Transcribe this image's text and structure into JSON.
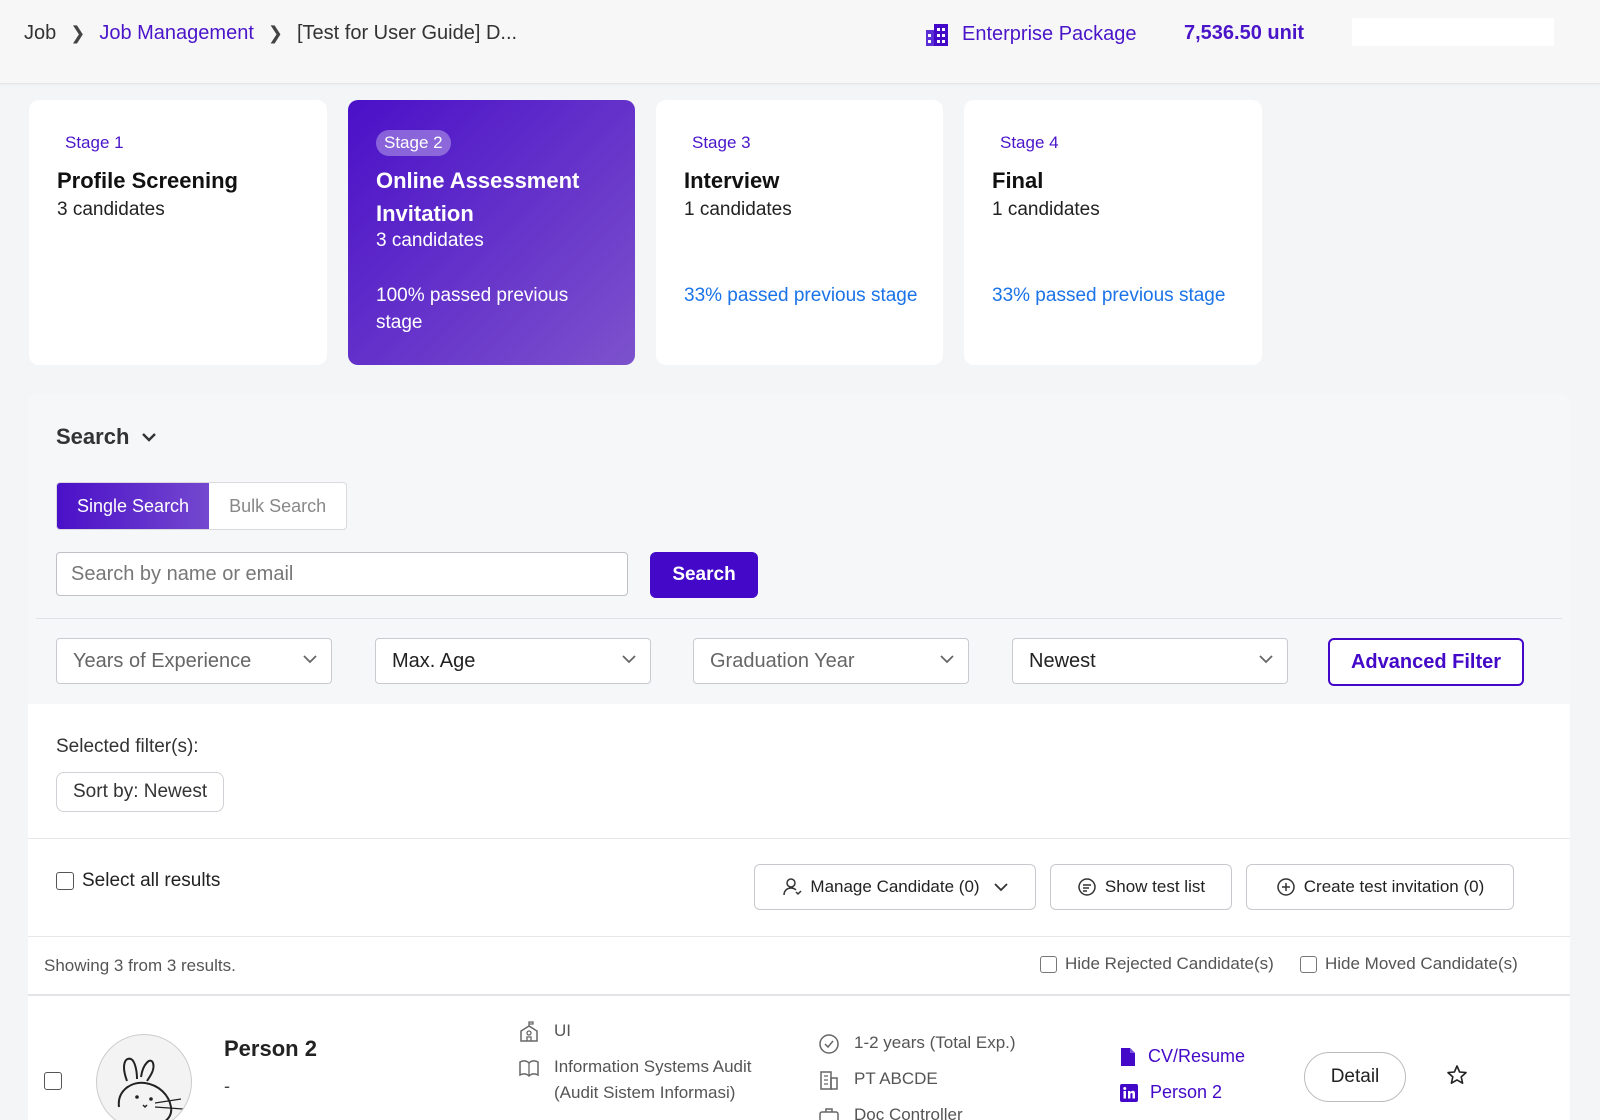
{
  "header": {
    "breadcrumb": [
      "Job",
      "Job Management",
      "[Test for User Guide] D..."
    ],
    "package_label": "Enterprise Package",
    "units": "7,536.50 unit",
    "accent_color": "#4308c8"
  },
  "stages": [
    {
      "label": "Stage 1",
      "title": "Profile Screening",
      "count": "3 candidates",
      "pass": ""
    },
    {
      "label": "Stage 2",
      "title": "Online Assessment Invitation",
      "count": "3 candidates",
      "pass": "100% passed previous stage"
    },
    {
      "label": "Stage 3",
      "title": "Interview",
      "count": "1 candidates",
      "pass": "33% passed previous stage"
    },
    {
      "label": "Stage 4",
      "title": "Final",
      "count": "1 candidates",
      "pass": "33% passed previous stage"
    }
  ],
  "search": {
    "heading": "Search",
    "tabs": [
      "Single Search",
      "Bulk Search"
    ],
    "placeholder": "Search by name or email",
    "button": "Search"
  },
  "filters": {
    "experience": "Years of Experience",
    "age": "Max. Age",
    "graduation": "Graduation Year",
    "sort": "Newest",
    "advanced": "Advanced Filter"
  },
  "selected": {
    "label": "Selected filter(s):",
    "chip": "Sort by: Newest"
  },
  "actions": {
    "select_all": "Select all results",
    "manage": "Manage Candidate (0)",
    "test_list": "Show test list",
    "create_invite": "Create test invitation (0)"
  },
  "results": {
    "showing": "Showing 3 from 3 results.",
    "hide_rejected": "Hide Rejected Candidate(s)",
    "hide_moved": "Hide Moved Candidate(s)"
  },
  "candidate": {
    "name": "Person 2",
    "subtitle": "-",
    "university": "UI",
    "major": "Information Systems Audit (Audit Sistem Informasi)",
    "experience": "1-2 years (Total Exp.)",
    "company": "PT ABCDE",
    "position": "Doc Controller",
    "cv_link": "CV/Resume",
    "linkedin": "Person 2",
    "detail": "Detail"
  }
}
